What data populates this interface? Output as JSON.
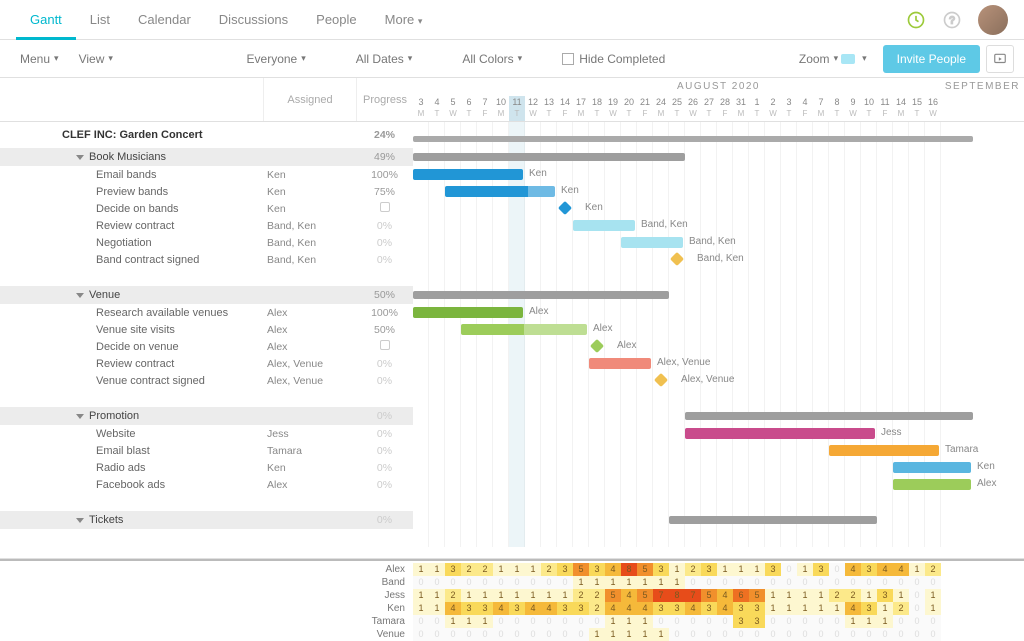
{
  "nav": {
    "tabs": [
      "Gantt",
      "List",
      "Calendar",
      "Discussions",
      "People",
      "More"
    ],
    "activeTab": "Gantt"
  },
  "toolbar": {
    "menu": "Menu",
    "view": "View",
    "filter_people": "Everyone",
    "filter_dates": "All Dates",
    "filter_colors": "All Colors",
    "hide_completed": "Hide Completed",
    "zoom": "Zoom",
    "invite": "Invite People"
  },
  "columns": {
    "assigned": "Assigned",
    "progress": "Progress"
  },
  "timeline": {
    "monthLabel": "AUGUST 2020",
    "monthLabel2": "SEPTEMBER",
    "days": [
      {
        "n": "3",
        "w": "M"
      },
      {
        "n": "4",
        "w": "T"
      },
      {
        "n": "5",
        "w": "W"
      },
      {
        "n": "6",
        "w": "T"
      },
      {
        "n": "7",
        "w": "F"
      },
      {
        "n": "10",
        "w": "M"
      },
      {
        "n": "11",
        "w": "T"
      },
      {
        "n": "12",
        "w": "W"
      },
      {
        "n": "13",
        "w": "T"
      },
      {
        "n": "14",
        "w": "F"
      },
      {
        "n": "17",
        "w": "M"
      },
      {
        "n": "18",
        "w": "T"
      },
      {
        "n": "19",
        "w": "W"
      },
      {
        "n": "20",
        "w": "T"
      },
      {
        "n": "21",
        "w": "F"
      },
      {
        "n": "24",
        "w": "M"
      },
      {
        "n": "25",
        "w": "T"
      },
      {
        "n": "26",
        "w": "W"
      },
      {
        "n": "27",
        "w": "T"
      },
      {
        "n": "28",
        "w": "F"
      },
      {
        "n": "31",
        "w": "M"
      },
      {
        "n": "1",
        "w": "T"
      },
      {
        "n": "2",
        "w": "W"
      },
      {
        "n": "3",
        "w": "T"
      },
      {
        "n": "4",
        "w": "F"
      },
      {
        "n": "7",
        "w": "M"
      },
      {
        "n": "8",
        "w": "T"
      },
      {
        "n": "9",
        "w": "W"
      },
      {
        "n": "10",
        "w": "T"
      },
      {
        "n": "11",
        "w": "F"
      },
      {
        "n": "14",
        "w": "M"
      },
      {
        "n": "15",
        "w": "T"
      },
      {
        "n": "16",
        "w": "W"
      }
    ],
    "todayIndex": 6
  },
  "project": {
    "title": "CLEF INC: Garden Concert",
    "progress": "24%"
  },
  "groups": [
    {
      "name": "Book Musicians",
      "progress": "49%",
      "summary": {
        "start": 0,
        "span": 17
      },
      "tasks": [
        {
          "name": "Email bands",
          "assigned": "Ken",
          "progress": "100%",
          "bar": {
            "start": 0,
            "span": 7,
            "color": "#2196d6",
            "label": "Ken"
          }
        },
        {
          "name": "Preview bands",
          "assigned": "Ken",
          "progress": "75%",
          "bar": {
            "start": 2,
            "span": 7,
            "color": "#2196d6",
            "pct": 75,
            "label": "Ken"
          }
        },
        {
          "name": "Decide on bands",
          "assigned": "Ken",
          "progress": "box",
          "milestone": {
            "at": 9,
            "color": "#2196d6",
            "label": "Ken"
          }
        },
        {
          "name": "Review contract",
          "assigned": "Band, Ken",
          "progress": "0%",
          "bar": {
            "start": 10,
            "span": 4,
            "color": "#a7e3f0",
            "label": "Band, Ken"
          }
        },
        {
          "name": "Negotiation",
          "assigned": "Band, Ken",
          "progress": "0%",
          "bar": {
            "start": 13,
            "span": 4,
            "color": "#a7e3f0",
            "label": "Band, Ken"
          }
        },
        {
          "name": "Band contract signed",
          "assigned": "Band, Ken",
          "progress": "0%",
          "milestone": {
            "at": 16,
            "color": "#f0c050",
            "label": "Band, Ken"
          }
        }
      ]
    },
    {
      "name": "Venue",
      "progress": "50%",
      "summary": {
        "start": 0,
        "span": 16
      },
      "tasks": [
        {
          "name": "Research available venues",
          "assigned": "Alex",
          "progress": "100%",
          "bar": {
            "start": 0,
            "span": 7,
            "color": "#7bb53e",
            "label": "Alex"
          }
        },
        {
          "name": "Venue site visits",
          "assigned": "Alex",
          "progress": "50%",
          "bar": {
            "start": 3,
            "span": 8,
            "color": "#9ccc5a",
            "pct": 50,
            "label": "Alex"
          }
        },
        {
          "name": "Decide on venue",
          "assigned": "Alex",
          "progress": "box",
          "milestone": {
            "at": 11,
            "color": "#9ccc5a",
            "label": "Alex"
          }
        },
        {
          "name": "Review contract",
          "assigned": "Alex, Venue",
          "progress": "0%",
          "bar": {
            "start": 11,
            "span": 4,
            "color": "#f08a7a",
            "label": "Alex, Venue"
          }
        },
        {
          "name": "Venue contract signed",
          "assigned": "Alex, Venue",
          "progress": "0%",
          "milestone": {
            "at": 15,
            "color": "#f0c050",
            "label": "Alex, Venue"
          }
        }
      ]
    },
    {
      "name": "Promotion",
      "progress": "0%",
      "summary": {
        "start": 17,
        "span": 18
      },
      "tasks": [
        {
          "name": "Website",
          "assigned": "Jess",
          "progress": "0%",
          "bar": {
            "start": 17,
            "span": 12,
            "color": "#c94b8c",
            "label": "Jess"
          }
        },
        {
          "name": "Email blast",
          "assigned": "Tamara",
          "progress": "0%",
          "bar": {
            "start": 26,
            "span": 7,
            "color": "#f5a835",
            "label": "Tamara"
          }
        },
        {
          "name": "Radio ads",
          "assigned": "Ken",
          "progress": "0%",
          "bar": {
            "start": 30,
            "span": 5,
            "color": "#5ab6e0",
            "label": "Ken"
          }
        },
        {
          "name": "Facebook ads",
          "assigned": "Alex",
          "progress": "0%",
          "bar": {
            "start": 30,
            "span": 5,
            "color": "#9ccc5a",
            "label": "Alex"
          }
        }
      ]
    },
    {
      "name": "Tickets",
      "progress": "0%",
      "summary": {
        "start": 16,
        "span": 13
      },
      "tasks": []
    }
  ],
  "heatmap": {
    "people": [
      "Alex",
      "Band",
      "Jess",
      "Ken",
      "Tamara",
      "Venue"
    ],
    "rows": [
      [
        1,
        1,
        3,
        2,
        2,
        1,
        1,
        1,
        2,
        3,
        5,
        3,
        4,
        8,
        5,
        3,
        1,
        2,
        3,
        1,
        1,
        1,
        3,
        0,
        1,
        3,
        0,
        4,
        3,
        4,
        4,
        1,
        2
      ],
      [
        0,
        0,
        0,
        0,
        0,
        0,
        0,
        0,
        0,
        0,
        1,
        1,
        1,
        1,
        1,
        1,
        1,
        0,
        0,
        0,
        0,
        0,
        0,
        0,
        0,
        0,
        0,
        0,
        0,
        0,
        0,
        0,
        0
      ],
      [
        1,
        1,
        2,
        1,
        1,
        1,
        1,
        1,
        1,
        1,
        2,
        2,
        5,
        4,
        5,
        7,
        8,
        7,
        5,
        4,
        6,
        5,
        1,
        1,
        1,
        1,
        2,
        2,
        1,
        3,
        1,
        0,
        1
      ],
      [
        1,
        1,
        4,
        3,
        3,
        4,
        3,
        4,
        4,
        3,
        3,
        2,
        4,
        4,
        4,
        3,
        3,
        4,
        3,
        4,
        3,
        3,
        1,
        1,
        1,
        1,
        1,
        4,
        3,
        1,
        2,
        0,
        1
      ],
      [
        0,
        0,
        1,
        1,
        1,
        0,
        0,
        0,
        0,
        0,
        0,
        0,
        1,
        1,
        1,
        0,
        0,
        0,
        0,
        0,
        3,
        3,
        0,
        0,
        0,
        0,
        0,
        1,
        1,
        1,
        0,
        0,
        0
      ],
      [
        0,
        0,
        0,
        0,
        0,
        0,
        0,
        0,
        0,
        0,
        0,
        1,
        1,
        1,
        1,
        1,
        0,
        0,
        0,
        0,
        0,
        0,
        0,
        0,
        0,
        0,
        0,
        0,
        0,
        0,
        0,
        0,
        0
      ]
    ]
  },
  "chart_data": {
    "type": "gantt",
    "title": "CLEF INC: Garden Concert",
    "time_axis": {
      "start": "2020-08-03",
      "end": "2020-09-16",
      "unit": "weekdays"
    },
    "overall_progress": 24,
    "groups": [
      {
        "name": "Book Musicians",
        "progress": 49,
        "span_days": 17
      },
      {
        "name": "Venue",
        "progress": 50,
        "span_days": 16
      },
      {
        "name": "Promotion",
        "progress": 0,
        "span_days": 18
      },
      {
        "name": "Tickets",
        "progress": 0,
        "span_days": 13
      }
    ],
    "tasks": [
      {
        "name": "Email bands",
        "group": "Book Musicians",
        "assigned": [
          "Ken"
        ],
        "progress": 100,
        "start_idx": 0,
        "duration": 7
      },
      {
        "name": "Preview bands",
        "group": "Book Musicians",
        "assigned": [
          "Ken"
        ],
        "progress": 75,
        "start_idx": 2,
        "duration": 7
      },
      {
        "name": "Decide on bands",
        "group": "Book Musicians",
        "assigned": [
          "Ken"
        ],
        "milestone_idx": 9
      },
      {
        "name": "Review contract",
        "group": "Book Musicians",
        "assigned": [
          "Band",
          "Ken"
        ],
        "progress": 0,
        "start_idx": 10,
        "duration": 4
      },
      {
        "name": "Negotiation",
        "group": "Book Musicians",
        "assigned": [
          "Band",
          "Ken"
        ],
        "progress": 0,
        "start_idx": 13,
        "duration": 4
      },
      {
        "name": "Band contract signed",
        "group": "Book Musicians",
        "assigned": [
          "Band",
          "Ken"
        ],
        "milestone_idx": 16
      },
      {
        "name": "Research available venues",
        "group": "Venue",
        "assigned": [
          "Alex"
        ],
        "progress": 100,
        "start_idx": 0,
        "duration": 7
      },
      {
        "name": "Venue site visits",
        "group": "Venue",
        "assigned": [
          "Alex"
        ],
        "progress": 50,
        "start_idx": 3,
        "duration": 8
      },
      {
        "name": "Decide on venue",
        "group": "Venue",
        "assigned": [
          "Alex"
        ],
        "milestone_idx": 11
      },
      {
        "name": "Review contract",
        "group": "Venue",
        "assigned": [
          "Alex",
          "Venue"
        ],
        "progress": 0,
        "start_idx": 11,
        "duration": 4
      },
      {
        "name": "Venue contract signed",
        "group": "Venue",
        "assigned": [
          "Alex",
          "Venue"
        ],
        "milestone_idx": 15
      },
      {
        "name": "Website",
        "group": "Promotion",
        "assigned": [
          "Jess"
        ],
        "progress": 0,
        "start_idx": 17,
        "duration": 12
      },
      {
        "name": "Email blast",
        "group": "Promotion",
        "assigned": [
          "Tamara"
        ],
        "progress": 0,
        "start_idx": 26,
        "duration": 7
      },
      {
        "name": "Radio ads",
        "group": "Promotion",
        "assigned": [
          "Ken"
        ],
        "progress": 0,
        "start_idx": 30,
        "duration": 5
      },
      {
        "name": "Facebook ads",
        "group": "Promotion",
        "assigned": [
          "Alex"
        ],
        "progress": 0,
        "start_idx": 30,
        "duration": 5
      }
    ]
  }
}
